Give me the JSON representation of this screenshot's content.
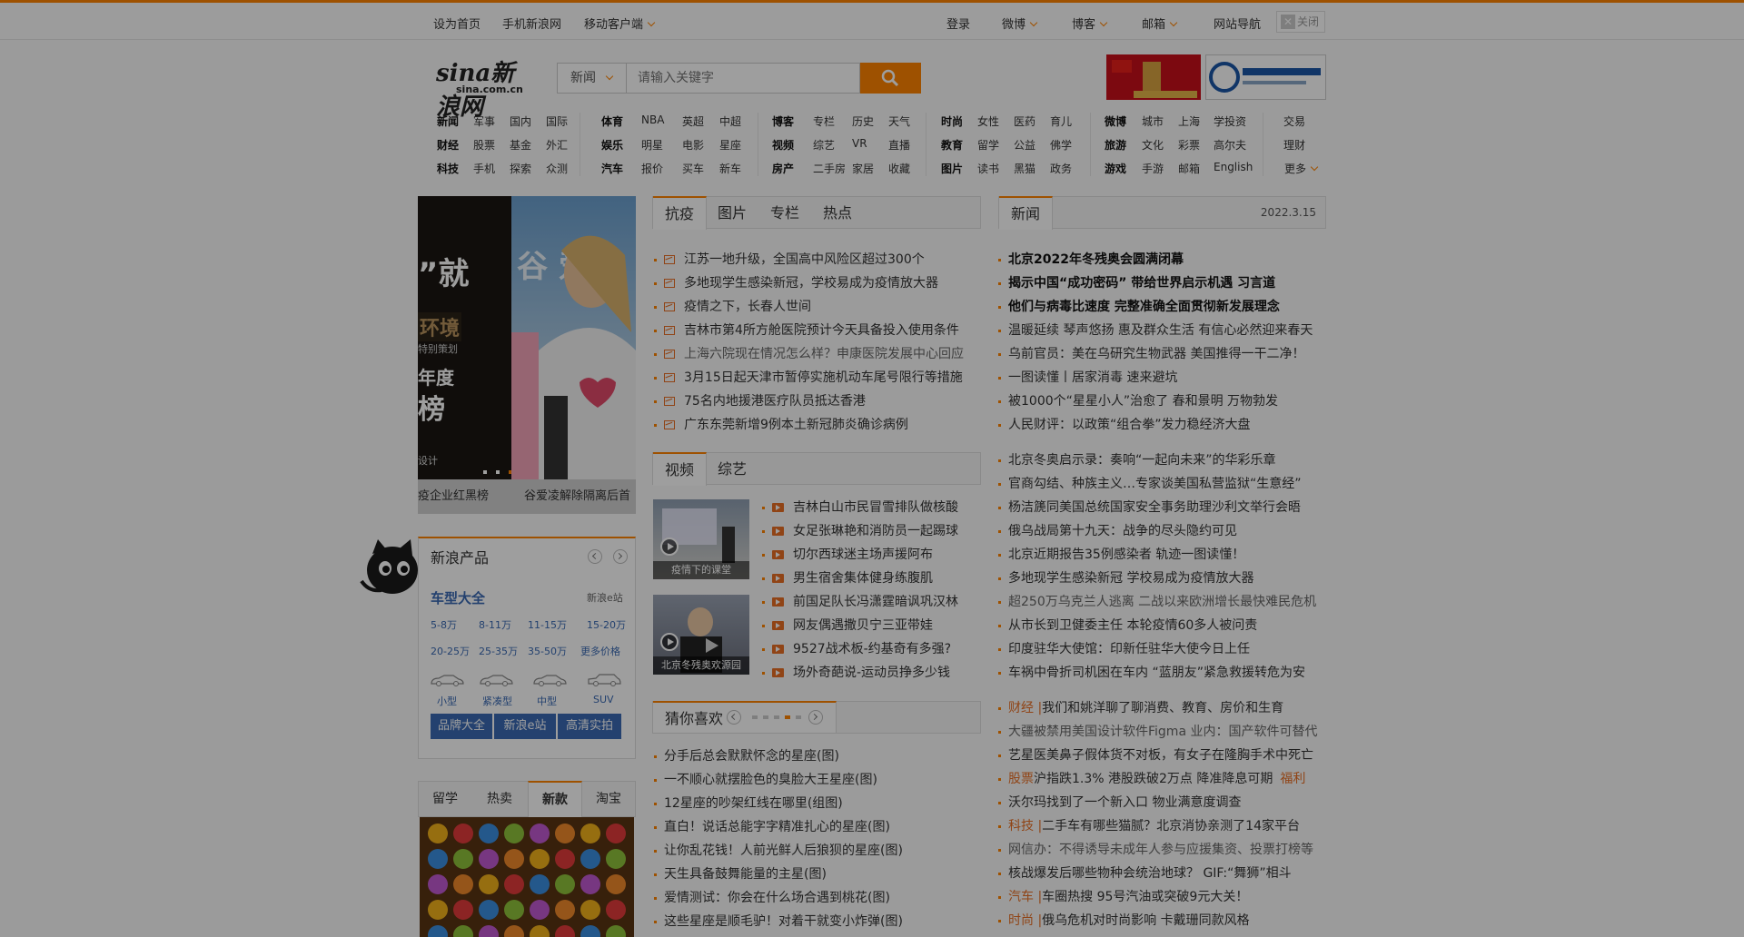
{
  "topbar": {
    "set_home": "设为首页",
    "mobile_site": "手机新浪网",
    "mobile_client": "移动客户端",
    "login": "登录",
    "weibo": "微博",
    "blog": "博客",
    "mail": "邮箱",
    "site_nav": "网站导航",
    "close": "关闭"
  },
  "logo": {
    "main": "sina新浪网",
    "sub": "sina.com.cn"
  },
  "search": {
    "category": "新闻",
    "placeholder": "请输入关键字"
  },
  "nav": {
    "col1": [
      [
        "新闻",
        "军事",
        "国内",
        "国际"
      ],
      [
        "财经",
        "股票",
        "基金",
        "外汇"
      ],
      [
        "科技",
        "手机",
        "探索",
        "众测"
      ]
    ],
    "col2": [
      [
        "体育",
        "NBA",
        "英超",
        "中超"
      ],
      [
        "娱乐",
        "明星",
        "电影",
        "星座"
      ],
      [
        "汽车",
        "报价",
        "买车",
        "新车"
      ]
    ],
    "col3": [
      [
        "博客",
        "专栏",
        "历史",
        "天气"
      ],
      [
        "视频",
        "综艺",
        "VR",
        "直播"
      ],
      [
        "房产",
        "二手房",
        "家居",
        "收藏"
      ]
    ],
    "col4": [
      [
        "时尚",
        "女性",
        "医药",
        "育儿"
      ],
      [
        "教育",
        "留学",
        "公益",
        "佛学"
      ],
      [
        "图片",
        "读书",
        "黑猫",
        "政务"
      ]
    ],
    "col5": [
      [
        "微博",
        "城市",
        "上海",
        "学投资"
      ],
      [
        "旅游",
        "文化",
        "彩票",
        "高尔夫"
      ],
      [
        "游戏",
        "手游",
        "邮箱",
        "English"
      ]
    ],
    "col6": [
      "交易",
      "理财",
      "更多"
    ]
  },
  "slider": {
    "left_texts": [
      "”就",
      "环境",
      "特别策划",
      "年度",
      "榜",
      "设计"
    ],
    "captions": [
      "疫企业红黑榜",
      "谷爱凌解除隔离后首"
    ]
  },
  "section1": {
    "tabs": [
      "抗疫",
      "图片",
      "专栏",
      "热点"
    ],
    "items": [
      "江苏一地升级，全国高中风险区超过300个",
      "多地现学生感染新冠，学校易成为疫情放大器",
      "疫情之下，长春人世间",
      "吉林市第4所方舱医院预计今天具备投入使用条件",
      "上海六院现在情况怎么样？申康医院发展中心回应",
      "3月15日起天津市暂停实施机动车尾号限行等措施",
      "75名内地援港医疗队员抵达香港",
      "广东东莞新增9例本土新冠肺炎确诊病例"
    ]
  },
  "section_video": {
    "tabs": [
      "视频",
      "综艺"
    ],
    "thumbs": [
      "疫情下的课堂",
      "北京冬残奥欢源园"
    ],
    "items": [
      "吉林白山市民冒雪排队做核酸",
      "女足张琳艳和消防员一起踢球",
      "切尔西球迷主场声援阿布",
      "男生宿舍集体健身练腹肌",
      "前国足队长冯潇霆暗讽巩汉林",
      "网友偶遇撒贝宁三亚带娃",
      "9527战术板-约基奇有多强?",
      "场外奇葩说-运动员挣多少钱"
    ]
  },
  "section_guess": {
    "title": "猜你喜欢",
    "items": [
      "分手后总会默默怀念的星座(图)",
      "一不顺心就摆脸色的臭脸大王星座(图)",
      "12星座的吵架红线在哪里(组图)",
      "直白！说话总能字字精准扎心的星座(图)",
      "让你乱花钱！人前光鲜人后狼狈的星座(图)",
      "天生具备鼓舞能量的主星(图)",
      "爱情测试：你会在什么场合遇到桃花(图)",
      "这些星座是顺毛驴！对着干就变小炸弹(图)"
    ]
  },
  "news": {
    "tab": "新闻",
    "date": "2022.3.15",
    "bold_items": [
      "北京2022年冬残奥会圆满闭幕",
      "揭示中国“成功密码” 带给世界启示机遇 习言道",
      "他们与病毒比速度 完整准确全面贯彻新发展理念"
    ],
    "items1": [
      "温暖延续 琴声悠扬 惠及群众生活 有信心必然迎来春天",
      "乌前官员：美在乌研究生物武器 美国推得一干二净！",
      "一图读懂丨居家消毒 速来避坑",
      "被1000个“星星小人”治愈了 春和景明 万物勃发",
      "人民财评：以政策“组合拳”发力稳经济大盘"
    ],
    "items2": [
      "北京冬奥启示录：奏响“一起向未来”的华彩乐章",
      "官商勾结、种族主义…专家谈美国私营监狱“生意经”",
      "杨洁篪同美国总统国家安全事务助理沙利文举行会晤",
      "俄乌战局第十九天：战争的尽头隐约可见",
      "北京近期报告35例感染者 轨迹一图读懂！",
      "多地现学生感染新冠 学校易成为疫情放大器",
      "超250万乌克兰人逃离 二战以来欧洲增长最快难民危机",
      "从市长到卫健委主任 本轮疫情60多人被问责",
      "印度驻华大使馆：印新任驻华大使今日上任",
      "车祸中骨折司机困在车内 “蓝朋友”紧急救援转危为安"
    ],
    "items3": [
      {
        "tag": "财经 |",
        "text": "我们和姚洋聊了聊消费、教育、房价和生育"
      },
      {
        "tag": "",
        "text": "大疆被禁用美国设计软件Figma 业内：国产软件可替代"
      },
      {
        "tag": "",
        "text": "艺星医美鼻子假体货不对板，有女子在隆胸手术中死亡"
      },
      {
        "tag": "股票",
        "text": "沪指跌1.3% 港股跌破2万点 降准降息可期",
        "extra": "福利"
      },
      {
        "tag": "",
        "text": "沃尔玛找到了一个新入口 物业满意度调查"
      },
      {
        "tag": "科技 |",
        "text": "二手车有哪些猫腻？北京消协亲测了14家平台"
      },
      {
        "tag": "",
        "text": "网信办：不得诱导未成年人参与应援集资、投票打榜等"
      },
      {
        "tag": "",
        "text": "核战爆发后哪些物种会统治地球？ GIF:“舞狮”相斗"
      },
      {
        "tag": "汽车 |",
        "text": "车圈热搜 95号汽油或突破9元大关！"
      },
      {
        "tag": "时尚 |",
        "text": "俄乌危机对时尚影响 卡戴珊同款风格"
      }
    ]
  },
  "products": {
    "title": "新浪产品",
    "car_title": "车型大全",
    "car_site": "新浪e站",
    "prices1": [
      "5-8万",
      "8-11万",
      "11-15万",
      "15-20万"
    ],
    "prices2": [
      "20-25万",
      "25-35万",
      "35-50万",
      "更多价格"
    ],
    "types": [
      "小型",
      "紧凑型",
      "中型",
      "SUV"
    ],
    "buttons": [
      "品牌大全",
      "新浪e站",
      "高清实拍"
    ]
  },
  "bottom_tabs": [
    "留学",
    "热卖",
    "新款",
    "淘宝"
  ]
}
